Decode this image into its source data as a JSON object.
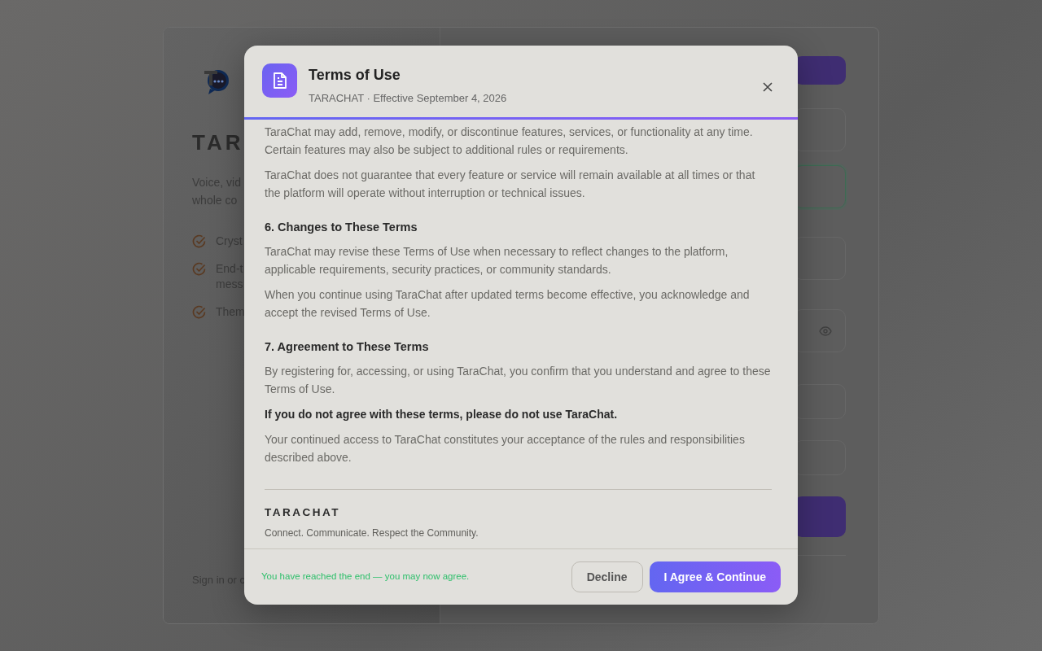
{
  "background": {
    "brand_title": "TAR",
    "description_lines": [
      "Voice, vid",
      "whole co"
    ],
    "features": [
      {
        "lines": [
          "Cryst"
        ]
      },
      {
        "lines": [
          "End-t",
          "mess"
        ]
      },
      {
        "lines": [
          "Them"
        ]
      }
    ],
    "footer_text": "Sign in or c",
    "right_fields": [
      {
        "kind": "button"
      },
      {
        "kind": "field",
        "focused": false
      },
      {
        "kind": "field",
        "focused": true
      },
      {
        "kind": "field",
        "focused": false
      },
      {
        "kind": "password",
        "focused": false
      },
      {
        "kind": "field",
        "focused": false
      },
      {
        "kind": "field",
        "focused": false
      },
      {
        "kind": "button"
      }
    ]
  },
  "modal": {
    "title": "Terms of Use",
    "subtitle": "TARACHAT · Effective September 4, 2026",
    "progress": {
      "level": 1
    },
    "content": [
      {
        "kind": "paragraph",
        "text": "TaraChat may add, remove, modify, or discontinue features, services, or functionality at any time. Certain features may also be subject to additional rules or requirements."
      },
      {
        "kind": "paragraph",
        "text": "TaraChat does not guarantee that every feature or service will remain available at all times or that the platform will operate without interruption or technical issues."
      },
      {
        "kind": "heading",
        "text": "6. Changes to These Terms"
      },
      {
        "kind": "paragraph",
        "text": "TaraChat may revise these Terms of Use when necessary to reflect changes to the platform, applicable requirements, security practices, or community standards."
      },
      {
        "kind": "paragraph",
        "text": "When you continue using TaraChat after updated terms become effective, you acknowledge and accept the revised Terms of Use."
      },
      {
        "kind": "heading",
        "text": "7. Agreement to These Terms"
      },
      {
        "kind": "paragraph",
        "text": "By registering for, accessing, or using TaraChat, you confirm that you understand and agree to these Terms of Use."
      },
      {
        "kind": "emphasis",
        "text": "If you do not agree with these terms, please do not use TaraChat."
      },
      {
        "kind": "paragraph",
        "text": "Your continued access to TaraChat constitutes your acceptance of the rules and responsibilities described above."
      }
    ],
    "brand": "TARACHAT",
    "tagline": "Connect. Communicate. Respect the Community.",
    "status": "You have reached the end — you may now agree.",
    "buttons": [
      {
        "label": "Decline",
        "kind": "secondary"
      },
      {
        "label": "I Agree & Continue",
        "kind": "primary"
      }
    ]
  }
}
